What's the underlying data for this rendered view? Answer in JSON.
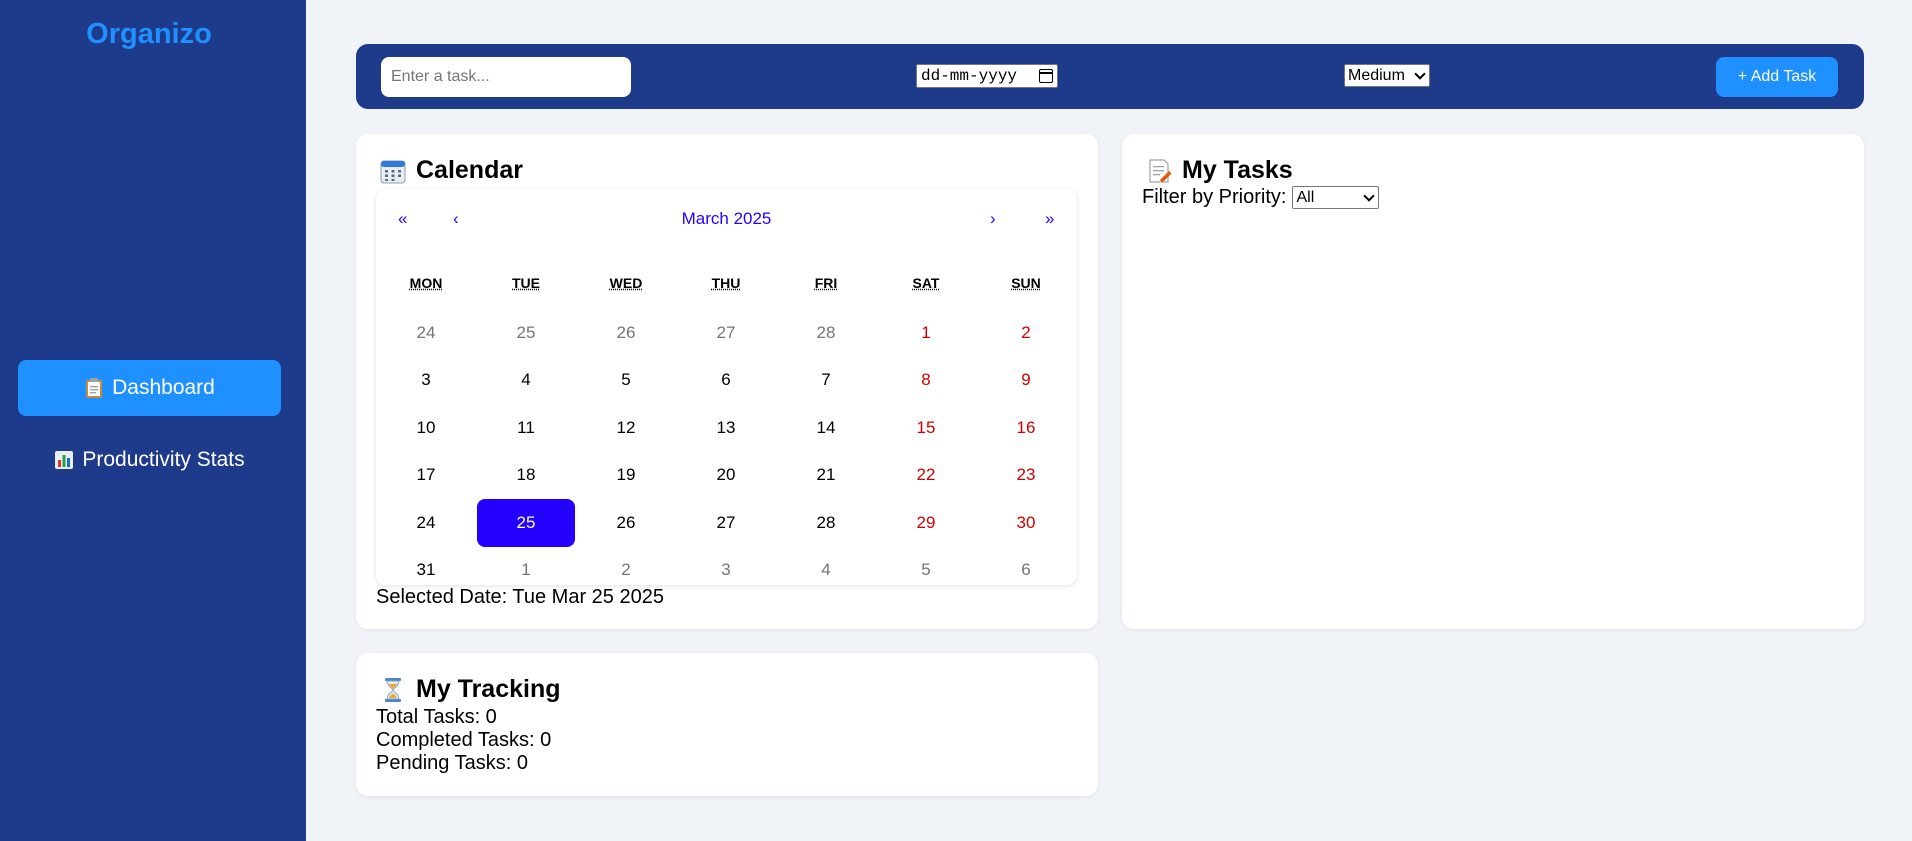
{
  "sidebar": {
    "brand": "Organizo",
    "items": [
      {
        "label": "Dashboard",
        "icon": "clipboard-icon",
        "active": true
      },
      {
        "label": "Productivity Stats",
        "icon": "bar-chart-icon",
        "active": false
      }
    ]
  },
  "toolbar": {
    "task_placeholder": "Enter a task...",
    "date_placeholder": "dd-mm-yyyy",
    "priority_value": "Medium",
    "add_label": "+ Add Task"
  },
  "calendar_card": {
    "title": "Calendar",
    "icon": "calendar-icon",
    "nav": {
      "prev_year": "«",
      "prev_month": "‹",
      "next_month": "›",
      "next_year": "»"
    },
    "month_label": "March 2025",
    "weekdays": [
      "MON",
      "TUE",
      "WED",
      "THU",
      "FRI",
      "SAT",
      "SUN"
    ],
    "weeks": [
      [
        "24",
        "25",
        "26",
        "27",
        "28",
        "1",
        "2"
      ],
      [
        "3",
        "4",
        "5",
        "6",
        "7",
        "8",
        "9"
      ],
      [
        "10",
        "11",
        "12",
        "13",
        "14",
        "15",
        "16"
      ],
      [
        "17",
        "18",
        "19",
        "20",
        "21",
        "22",
        "23"
      ],
      [
        "24",
        "25",
        "26",
        "27",
        "28",
        "29",
        "30"
      ],
      [
        "31",
        "1",
        "2",
        "3",
        "4",
        "5",
        "6"
      ]
    ],
    "selected_label": "Selected Date: Tue Mar 25 2025"
  },
  "tasks_card": {
    "title": "My Tasks",
    "icon": "memo-icon",
    "filter_label": "Filter by Priority:",
    "filter_value": "All"
  },
  "tracking_card": {
    "title": "My Tracking",
    "icon": "hourglass-icon",
    "total": "Total Tasks: 0",
    "completed": "Completed Tasks: 0",
    "pending": "Pending Tasks: 0"
  },
  "colors": {
    "sidebar_bg": "#1e3a8a",
    "accent": "#1e90ff",
    "calendar_accent": "#2400ff",
    "weekend": "#d10000"
  }
}
